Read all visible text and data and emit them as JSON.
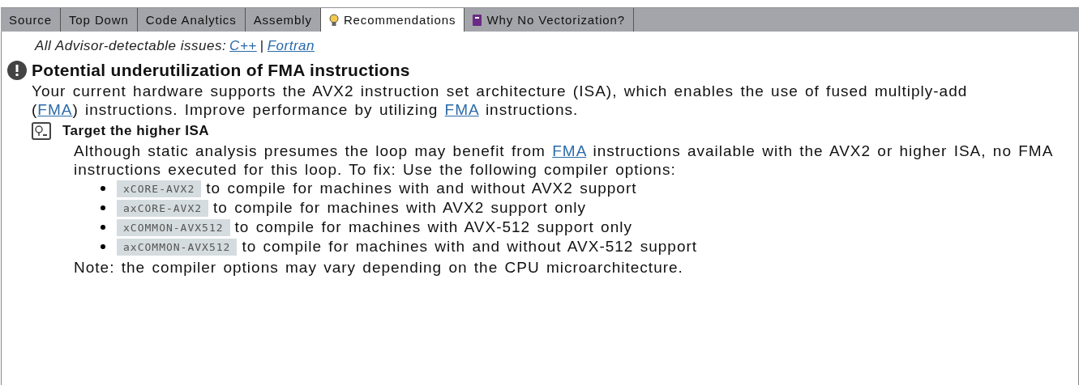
{
  "tabs": [
    {
      "label": "Source",
      "selected": false
    },
    {
      "label": "Top Down",
      "selected": false
    },
    {
      "label": "Code Analytics",
      "selected": false
    },
    {
      "label": "Assembly",
      "selected": false
    },
    {
      "label": "Recommendations",
      "selected": true,
      "kind": "bulb"
    },
    {
      "label": "Why No Vectorization?",
      "selected": false,
      "kind": "book"
    }
  ],
  "issues_line": {
    "label": "All Advisor-detectable issues:",
    "links": [
      "C++",
      "Fortran"
    ],
    "separator": "|"
  },
  "issue": {
    "title": "Potential underutilization of FMA instructions",
    "description": [
      {
        "text": "Your current hardware supports the AVX2 instruction set architecture (ISA), which enables the use of fused multiply-add ("
      },
      {
        "link": "FMA"
      },
      {
        "text": ") instructions. Improve performance by utilizing "
      },
      {
        "link": "FMA"
      },
      {
        "text": " instructions."
      }
    ],
    "recommendation": {
      "title": "Target the higher ISA",
      "description": [
        {
          "text": "Although static analysis presumes the loop may benefit from "
        },
        {
          "link": "FMA"
        },
        {
          "text": " instructions available with the AVX2 or higher ISA, no FMA instructions executed for this loop. To fix: Use the following compiler options:"
        }
      ],
      "options": [
        {
          "code": "xCORE-AVX2",
          "text": "to compile for machines with and without AVX2 support"
        },
        {
          "code": "axCORE-AVX2",
          "text": "to compile for machines with AVX2 support only"
        },
        {
          "code": "xCOMMON-AVX512",
          "text": "to compile for machines with AVX-512 support only"
        },
        {
          "code": "axCOMMON-AVX512",
          "text": "to compile for machines with and without AVX-512 support"
        }
      ],
      "note": "Note: the compiler options may vary depending on the CPU microarchitecture."
    }
  }
}
